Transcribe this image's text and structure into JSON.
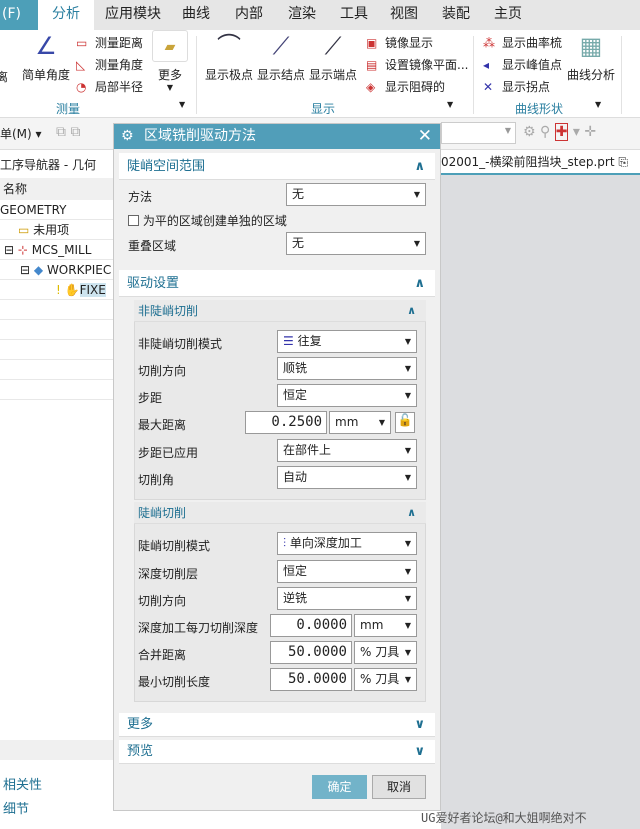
{
  "menu": {
    "tabs": [
      "(F)",
      "分析",
      "应用模块",
      "曲线",
      "内部",
      "渲染",
      "工具",
      "视图",
      "装配",
      "主页"
    ],
    "active": "分析"
  },
  "ribbon": {
    "measure": {
      "distance_partial": "离",
      "simple_angle": "简单角度",
      "measure_distance": "测量距离",
      "measure_angle": "测量角度",
      "local_radius": "局部半径",
      "more": "更多",
      "group": "测量"
    },
    "display": {
      "show_poles": "显示极点",
      "show_knots": "显示结点",
      "show_endpoints": "显示端点",
      "mirror_display": "镜像显示",
      "set_mirror_plane": "设置镜像平面...",
      "show_obstruct": "显示阻碍的",
      "group": "显示"
    },
    "curve_shape": {
      "show_curvature_comb": "显示曲率梳",
      "show_peak": "显示峰值点",
      "show_inflection": "显示拐点",
      "curve_analysis": "曲线分析",
      "group": "曲线形状"
    }
  },
  "toolbar": {
    "menu_label": "单(M)"
  },
  "navigator": {
    "title": "工序导航器 - 几何",
    "column": "名称",
    "rows": [
      "GEOMETRY",
      "未用项",
      "MCS_MILL",
      "WORKPIEC",
      "FIXE"
    ],
    "related": "相关性",
    "details": "细节"
  },
  "file_tab": "02001_-横梁前阻挡块_step.prt",
  "watermark": "UG爱好者论坛@和大姐啊绝对不",
  "dialog": {
    "title": "区域铣削驱动方法",
    "steep_range": {
      "title": "陡峭空间范围",
      "method_label": "方法",
      "method_value": "无",
      "checkbox_label": "为平的区域创建单独的区域",
      "overlap_label": "重叠区域",
      "overlap_value": "无"
    },
    "drive": {
      "title": "驱动设置",
      "nonsteep": {
        "title": "非陡峭切削",
        "pattern_label": "非陡峭切削模式",
        "pattern_value": "往复",
        "direction_label": "切削方向",
        "direction_value": "顺铣",
        "stepover_label": "步距",
        "stepover_value": "恒定",
        "maxdist_label": "最大距离",
        "maxdist_value": "0.2500",
        "maxdist_unit": "mm",
        "applied_label": "步距已应用",
        "applied_value": "在部件上",
        "angle_label": "切削角",
        "angle_value": "自动"
      },
      "steep": {
        "title": "陡峭切削",
        "pattern_label": "陡峭切削模式",
        "pattern_value": "单向深度加工",
        "levels_label": "深度切削层",
        "levels_value": "恒定",
        "direction_label": "切削方向",
        "direction_value": "逆铣",
        "depth_label": "深度加工每刀切削深度",
        "depth_value": "0.0000",
        "depth_unit": "mm",
        "merge_label": "合并距离",
        "merge_value": "50.0000",
        "merge_unit": "% 刀具",
        "minlen_label": "最小切削长度",
        "minlen_value": "50.0000",
        "minlen_unit": "% 刀具"
      }
    },
    "more": "更多",
    "preview": "预览",
    "ok": "确定",
    "cancel": "取消"
  },
  "colors": {
    "accent": "#519eb9",
    "section_text": "#1e6f91",
    "ok_button": "#72b3c9"
  }
}
